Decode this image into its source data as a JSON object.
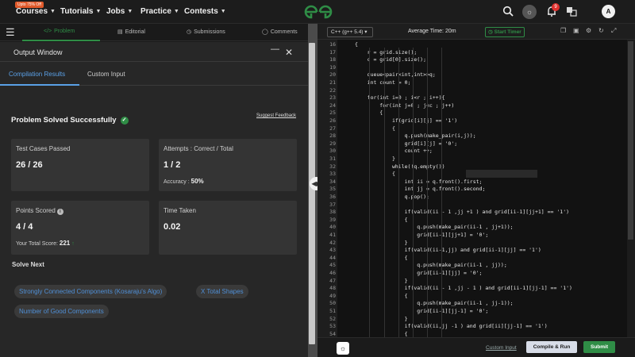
{
  "topbar": {
    "offer_badge": "Upto 75% Off",
    "nav": [
      "Courses",
      "Tutorials",
      "Jobs",
      "Practice",
      "Contests"
    ],
    "notification_count": "9",
    "avatar_initial": "A"
  },
  "left_tabs": {
    "problem": "Problem",
    "editorial": "Editorial",
    "submissions": "Submissions",
    "comments": "Comments"
  },
  "output_window": {
    "title": "Output Window",
    "tabs": [
      "Compilation Results",
      "Custom Input"
    ],
    "status": "Problem Solved Successfully",
    "suggest_feedback": "Suggest Feedback",
    "cards": {
      "test_cases_label": "Test Cases Passed",
      "test_cases_value": "26 / 26",
      "attempts_label": "Attempts : Correct / Total",
      "attempts_value": "1 / 2",
      "accuracy_label": "Accuracy :",
      "accuracy_value": "50%",
      "points_label": "Points Scored",
      "points_value": "4 / 4",
      "total_score_label": "Your Total Score:",
      "total_score_value": "221",
      "time_label": "Time Taken",
      "time_value": "0.02"
    },
    "solve_next_label": "Solve Next",
    "solve_next": [
      "Strongly Connected Components (Kosaraju's Algo)",
      "X Total Shapes",
      "Number of Good Components"
    ]
  },
  "editor": {
    "language": "C++ (g++ 5.4)",
    "average_time": "Average Time: 20m",
    "start_timer": "Start Timer",
    "line_numbers": [
      "16",
      "17",
      "18",
      "19",
      "20",
      "21",
      "22",
      "23",
      "24",
      "25",
      "26",
      "27",
      "28",
      "29",
      "30",
      "31",
      "32",
      "33",
      "34",
      "35",
      "36",
      "37",
      "38",
      "39",
      "40",
      "41",
      "42",
      "43",
      "44",
      "45",
      "46",
      "47",
      "48",
      "49",
      "50",
      "51",
      "52",
      "53",
      "54"
    ],
    "code_lines": [
      "{",
      "    r = grid.size();",
      "    c = grid[0].size();",
      "",
      "    queue<pair<int,int>>q;",
      "    int count = 0;",
      "",
      "    for(int i=0 ; i<r ; i++){",
      "        for(int j=0 ; j<c ; j++)",
      "        {",
      "            if(grid[i][j] == '1')",
      "            {",
      "                q.push(make_pair(i,j));",
      "                grid[i][j] = '0';",
      "                count ++;",
      "            }",
      "            while(!q.empty())",
      "            {",
      "                int ii = q.front().first;",
      "                int jj = q.front().second;",
      "                q.pop();",
      "",
      "                if(valid(ii - 1 ,jj +1 ) and grid[ii-1][jj+1] == '1')",
      "                {",
      "                    q.push(make_pair(ii-1 , jj+1));",
      "                    grid[ii-1][jj+1] = '0';",
      "                }",
      "                if(valid(ii-1,jj) and grid[ii-1][jj] == '1')",
      "                {",
      "                    q.push(make_pair(ii-1 , jj));",
      "                    grid[ii-1][jj] = '0';",
      "                }",
      "                if(valid(ii - 1 ,jj - 1 ) and grid[ii-1][jj-1] == '1')",
      "                {",
      "                    q.push(make_pair(ii-1 , jj-1));",
      "                    grid[ii-1][jj-1] = '0';",
      "                }",
      "                if(valid(ii,jj -1 ) and grid[ii][jj-1] == '1')",
      "                {"
    ],
    "custom_input": "Custom Input",
    "compile_run": "Compile & Run",
    "submit": "Submit"
  },
  "colors": {
    "brand_green": "#2f8d46",
    "link_blue": "#5aa0e6"
  }
}
